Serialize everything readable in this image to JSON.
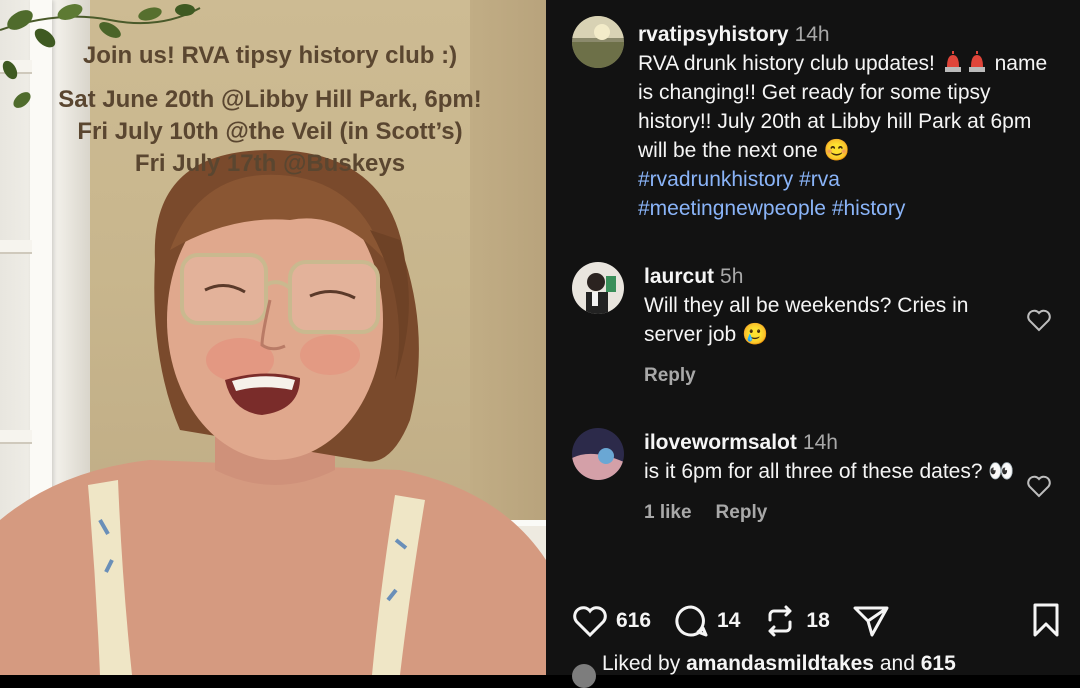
{
  "video": {
    "overlay_title": "Join us! RVA tipsy history club :)",
    "overlay_dates": [
      "Sat June 20th @Libby Hill Park, 6pm!",
      "Fri July 10th @the Veil (in Scott’s)",
      "Fri July 17th @Buskeys"
    ]
  },
  "post": {
    "username": "rvatipsyhistory",
    "time": "14h",
    "caption_1": "RVA drunk history club updates!",
    "caption_2": "name is changing!! Get ready for some tipsy history!! July 20th at Libby hill Park at 6pm will be the next one",
    "emoji_smile": "😊",
    "hashtags": [
      "#rvadrunkhistory",
      "#rva",
      "#meetingnewpeople",
      "#history"
    ]
  },
  "comments": [
    {
      "username": "laurcut",
      "time": "5h",
      "text": "Will they all be weekends? Cries in server job",
      "emoji": "🥲",
      "likes": "",
      "reply": "Reply"
    },
    {
      "username": "ilovewormsalot",
      "time": "14h",
      "text": "is it 6pm for all three of these dates?",
      "emoji": "👀",
      "likes": "1 like",
      "reply": "Reply"
    }
  ],
  "actions": {
    "likes": "616",
    "comments": "14",
    "reposts": "18"
  },
  "liked_by": {
    "prefix": "Liked by",
    "user": "amandasmildtakes",
    "suffix": "and",
    "count": "615"
  },
  "colors": {
    "panel_bg": "#121212",
    "hashtag": "#8ab4f8",
    "muted": "#a8a8a8",
    "overlay_text": "#5a4630",
    "siren_red": "#e0453a"
  }
}
